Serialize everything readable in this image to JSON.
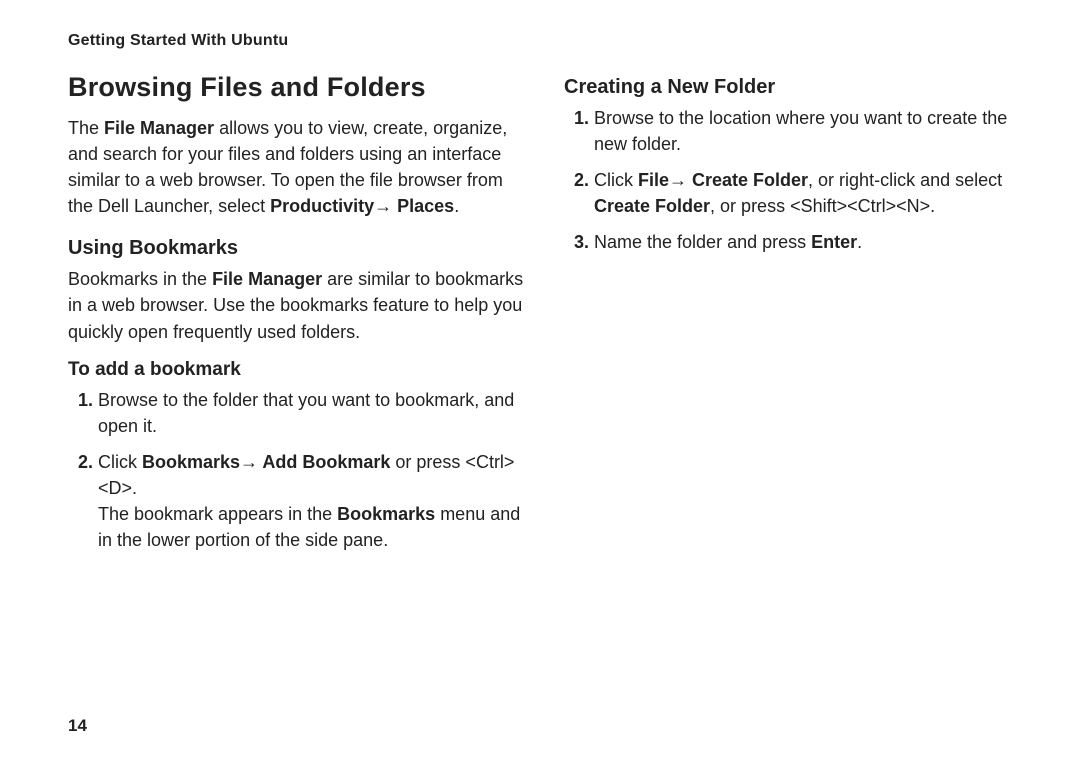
{
  "header": "Getting Started With Ubuntu",
  "pageNumber": "14",
  "left": {
    "h1": "Browsing Files and Folders",
    "intro_pre": "The ",
    "intro_b1": "File Manager",
    "intro_mid": " allows you to view, create, organize, and search for your files and folders using an interface similar to a web browser. To open the file browser from the Dell Launcher, select ",
    "intro_b2": "Productivity→ Places",
    "intro_post": ".",
    "h2": "Using Bookmarks",
    "bm_pre": "Bookmarks in the ",
    "bm_b1": "File Manager",
    "bm_post": " are similar to bookmarks in a web browser. Use the bookmarks feature to help you quickly open frequently used folders.",
    "h3": "To add a bookmark",
    "step1": "Browse to the folder that you want to bookmark, and open it.",
    "step2_pre": "Click ",
    "step2_b1": "Bookmarks→ Add Bookmark",
    "step2_mid": " or press <Ctrl><D>.",
    "step2_line2_pre": "The bookmark appears in the ",
    "step2_line2_b": "Bookmarks",
    "step2_line2_post": " menu and in the lower portion of the side pane."
  },
  "right": {
    "h2": "Creating a New Folder",
    "step1": "Browse to the location where you want to create the new folder.",
    "step2_pre": "Click ",
    "step2_b1": "File→ Create Folder",
    "step2_mid": ", or right-click and select ",
    "step2_b2": "Create Folder",
    "step2_post": ", or press <Shift><Ctrl><N>.",
    "step3_pre": "Name the folder and press ",
    "step3_b1": "Enter",
    "step3_post": "."
  }
}
